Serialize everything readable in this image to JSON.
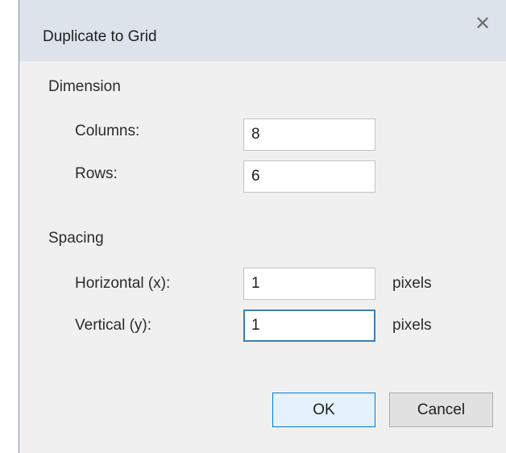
{
  "dialog": {
    "title": "Duplicate to Grid",
    "close_glyph": "✕",
    "close_icon": "close-icon"
  },
  "dimension": {
    "section_label": "Dimension",
    "columns_label": "Columns:",
    "columns_value": "8",
    "rows_label": "Rows:",
    "rows_value": "6"
  },
  "spacing": {
    "section_label": "Spacing",
    "horizontal_label": "Horizontal (x):",
    "horizontal_value": "1",
    "horizontal_unit": "pixels",
    "vertical_label": "Vertical (y):",
    "vertical_value": "1",
    "vertical_unit": "pixels"
  },
  "buttons": {
    "ok_label": "OK",
    "cancel_label": "Cancel"
  },
  "colors": {
    "titlebar": "#dde3eb",
    "dialog_bg": "#f0f0f0",
    "focus_border": "#3c7fb1",
    "default_button_border": "#0078d7"
  }
}
